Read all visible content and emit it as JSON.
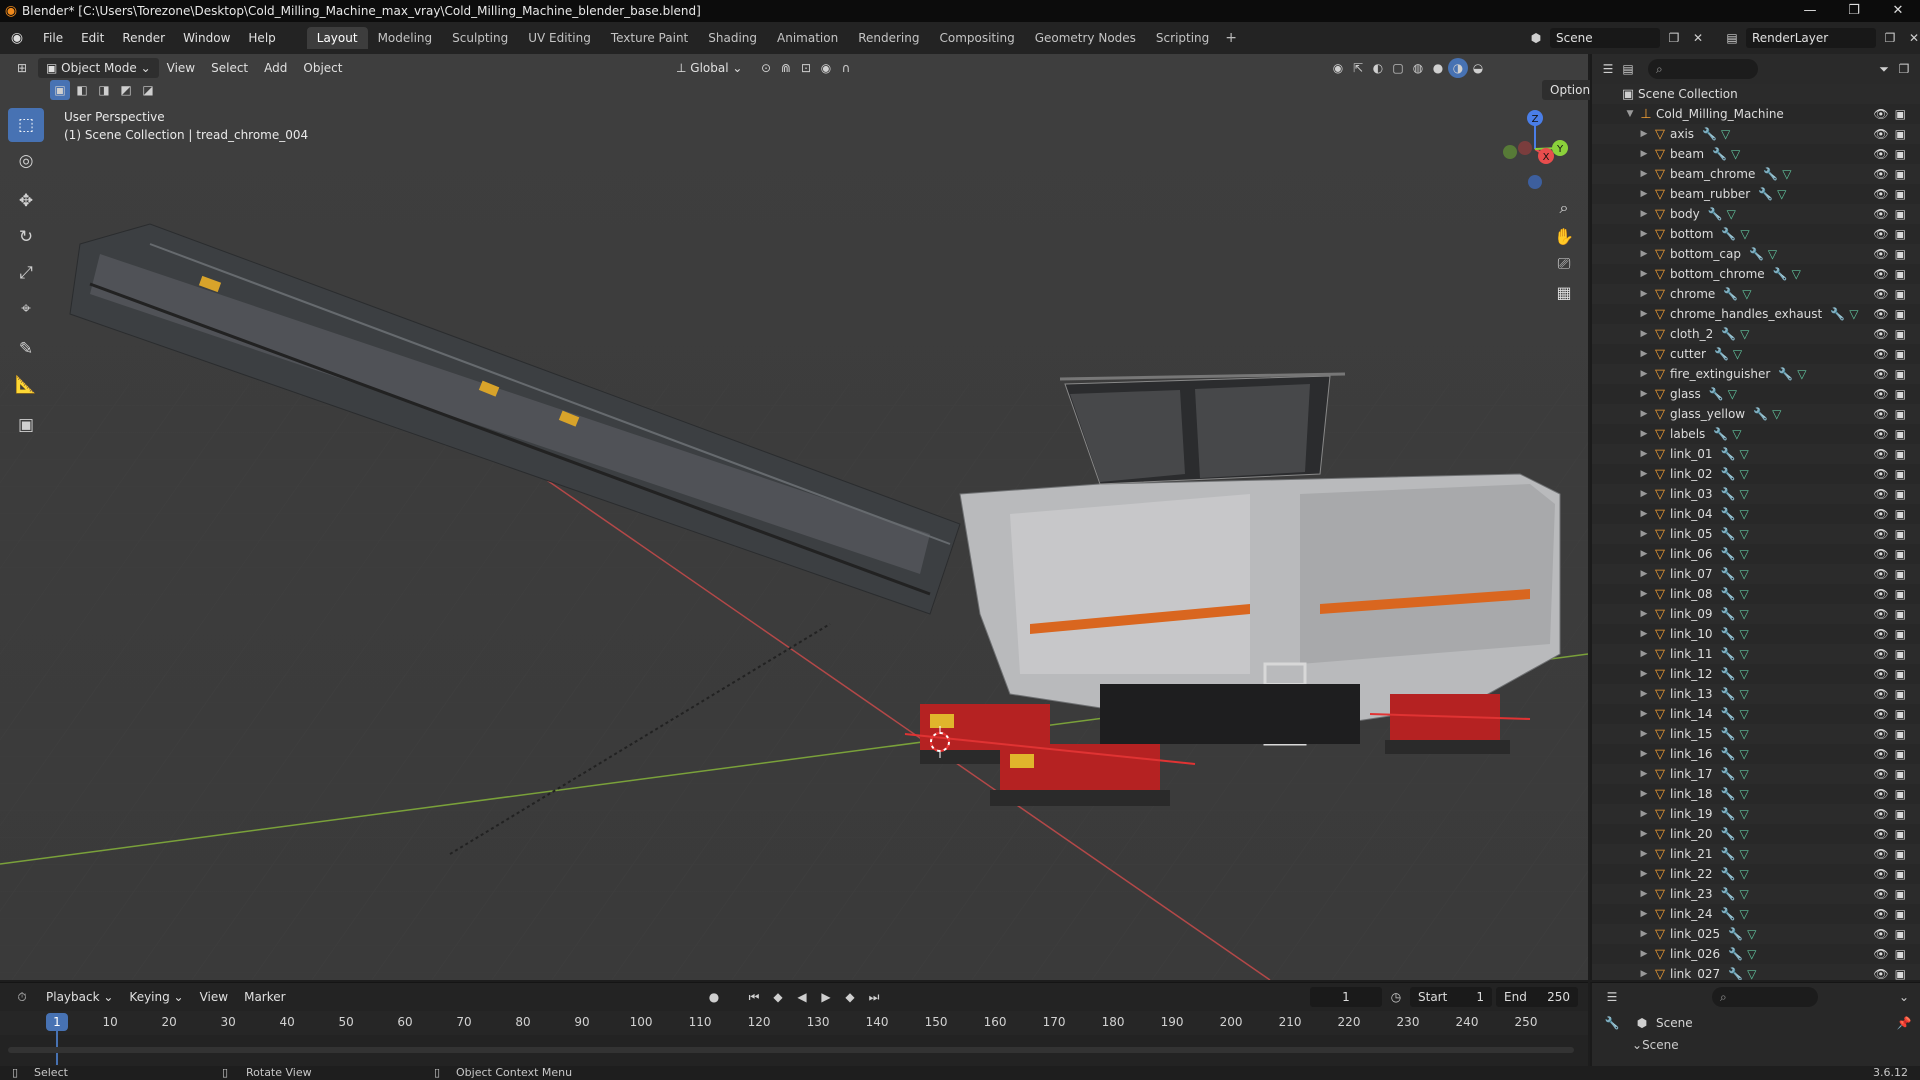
{
  "window": {
    "title": "Blender* [C:\\Users\\Torezone\\Desktop\\Cold_Milling_Machine_max_vray\\Cold_Milling_Machine_blender_base.blend]",
    "controls": [
      "—",
      "❐",
      "✕"
    ]
  },
  "menubar": {
    "menus": [
      "File",
      "Edit",
      "Render",
      "Window",
      "Help"
    ],
    "workspaces": [
      "Layout",
      "Modeling",
      "Sculpting",
      "UV Editing",
      "Texture Paint",
      "Shading",
      "Animation",
      "Rendering",
      "Compositing",
      "Geometry Nodes",
      "Scripting"
    ],
    "active_workspace": "Layout",
    "add_tab": "+",
    "scene": "Scene",
    "view_layer": "RenderLayer"
  },
  "viewport_header": {
    "mode": "Object Mode",
    "menus": [
      "View",
      "Select",
      "Add",
      "Object"
    ],
    "orientation": "Global",
    "options": "Options"
  },
  "viewport": {
    "perspective": "User Perspective",
    "collection_info": "(1) Scene Collection | tread_chrome_004",
    "gizmo_axes": {
      "z": "Z",
      "x": "X",
      "y": "Y"
    },
    "colors": {
      "x_axis": "#e84d4d",
      "y_axis": "#8bd13b",
      "z_axis": "#4a7ee8",
      "accent": "#4772b3"
    }
  },
  "toolbar": {
    "tools": [
      "select-box",
      "cursor",
      "move",
      "rotate",
      "scale",
      "transform",
      "annotate",
      "measure",
      "add-cube"
    ],
    "glyphs": [
      "⬚",
      "◎",
      "✥",
      "↻",
      "⤢",
      "⌖",
      "✎",
      "📐",
      "▣"
    ]
  },
  "outliner": {
    "root": "Scene Collection",
    "collection": "Cold_Milling_Machine",
    "objects": [
      "axis",
      "beam",
      "beam_chrome",
      "beam_rubber",
      "body",
      "bottom",
      "bottom_cap",
      "bottom_chrome",
      "chrome",
      "chrome_handles_exhaust",
      "cloth_2",
      "cutter",
      "fire_extinguisher",
      "glass",
      "glass_yellow",
      "labels",
      "link_01",
      "link_02",
      "link_03",
      "link_04",
      "link_05",
      "link_06",
      "link_07",
      "link_08",
      "link_09",
      "link_10",
      "link_11",
      "link_12",
      "link_13",
      "link_14",
      "link_15",
      "link_16",
      "link_17",
      "link_18",
      "link_19",
      "link_20",
      "link_21",
      "link_22",
      "link_23",
      "link_24",
      "link_025",
      "link_026",
      "link_027"
    ]
  },
  "timeline": {
    "menus": [
      "Playback",
      "Keying",
      "View",
      "Marker"
    ],
    "current_frame": "1",
    "start_label": "Start",
    "start": "1",
    "end_label": "End",
    "end": "250",
    "ticks": [
      "1",
      "10",
      "20",
      "30",
      "40",
      "50",
      "60",
      "70",
      "80",
      "90",
      "100",
      "110",
      "120",
      "130",
      "140",
      "150",
      "160",
      "170",
      "180",
      "190",
      "200",
      "210",
      "220",
      "230",
      "240",
      "250"
    ]
  },
  "properties": {
    "scene": "Scene",
    "section": "Scene"
  },
  "statusbar": {
    "select": "Select",
    "rotate": "Rotate View",
    "context": "Object Context Menu",
    "version": "3.6.12"
  }
}
